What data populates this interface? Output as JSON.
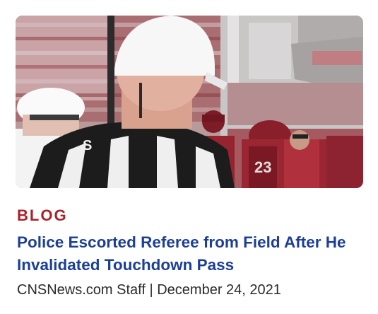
{
  "card": {
    "category": "BLOG",
    "headline": "Police Escorted Referee from Field After He Invalidated Touchdown Pass",
    "author": "CNSNews.com Staff",
    "separator": "|",
    "date": "December 24, 2021"
  },
  "colors": {
    "category": "#a8222c",
    "headline": "#1d3f95",
    "byline": "#2b2b2b"
  }
}
